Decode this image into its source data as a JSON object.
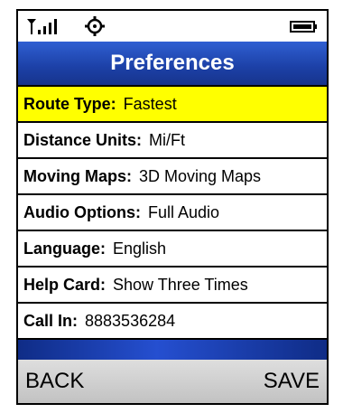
{
  "colors": {
    "title_bar": "#1c40a6",
    "selected_row": "#ffff00",
    "softkey_bar": "#cfcfcf"
  },
  "status_bar": {
    "icons": [
      "signal-strength-icon",
      "settings-icon",
      "battery-icon"
    ]
  },
  "header": {
    "title": "Preferences"
  },
  "preferences": [
    {
      "label": "Route Type:",
      "value": "Fastest"
    },
    {
      "label": "Distance Units:",
      "value": "Mi/Ft"
    },
    {
      "label": "Moving Maps:",
      "value": "3D Moving Maps"
    },
    {
      "label": "Audio Options:",
      "value": "Full Audio"
    },
    {
      "label": "Language:",
      "value": "English"
    },
    {
      "label": "Help Card:",
      "value": "Show Three Times"
    },
    {
      "label": "Call In:",
      "value": "8883536284"
    }
  ],
  "selected_index": 0,
  "softkeys": {
    "left": "BACK",
    "right": "SAVE"
  }
}
